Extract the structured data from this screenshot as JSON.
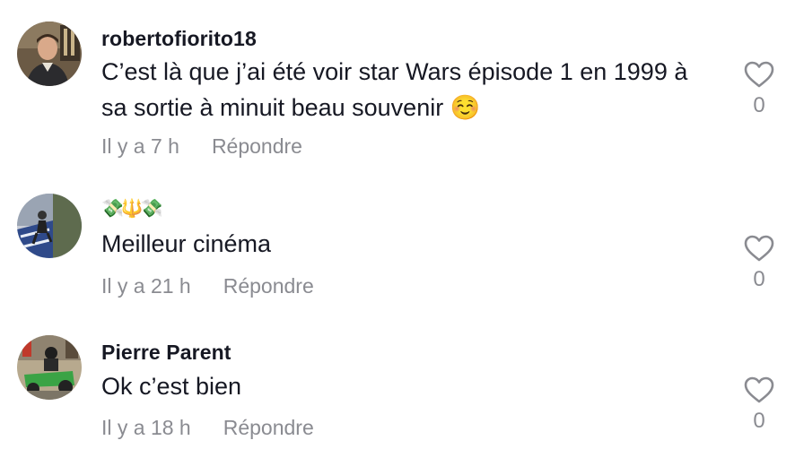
{
  "comments": [
    {
      "username": "robertofiorito18",
      "text": "C’est là que j’ai été voir star Wars épisode 1 en 1999 à sa sortie à minuit beau souvenir ☺️",
      "time": "Il y a 7 h",
      "reply_label": "Répondre",
      "likes": "0",
      "avatar_icon": "person-avatar-icon"
    },
    {
      "username": "💸🔱💸",
      "text": "Meilleur cinéma",
      "time": "Il y a 21 h",
      "reply_label": "Répondre",
      "likes": "0",
      "avatar_icon": "skate-avatar-icon"
    },
    {
      "username": "Pierre Parent",
      "text": "Ok c’est bien",
      "time": "Il y a 18 h",
      "reply_label": "Répondre",
      "likes": "0",
      "avatar_icon": "mower-avatar-icon"
    }
  ],
  "colors": {
    "text": "#161823",
    "muted": "#8a8b91",
    "background": "#ffffff"
  }
}
